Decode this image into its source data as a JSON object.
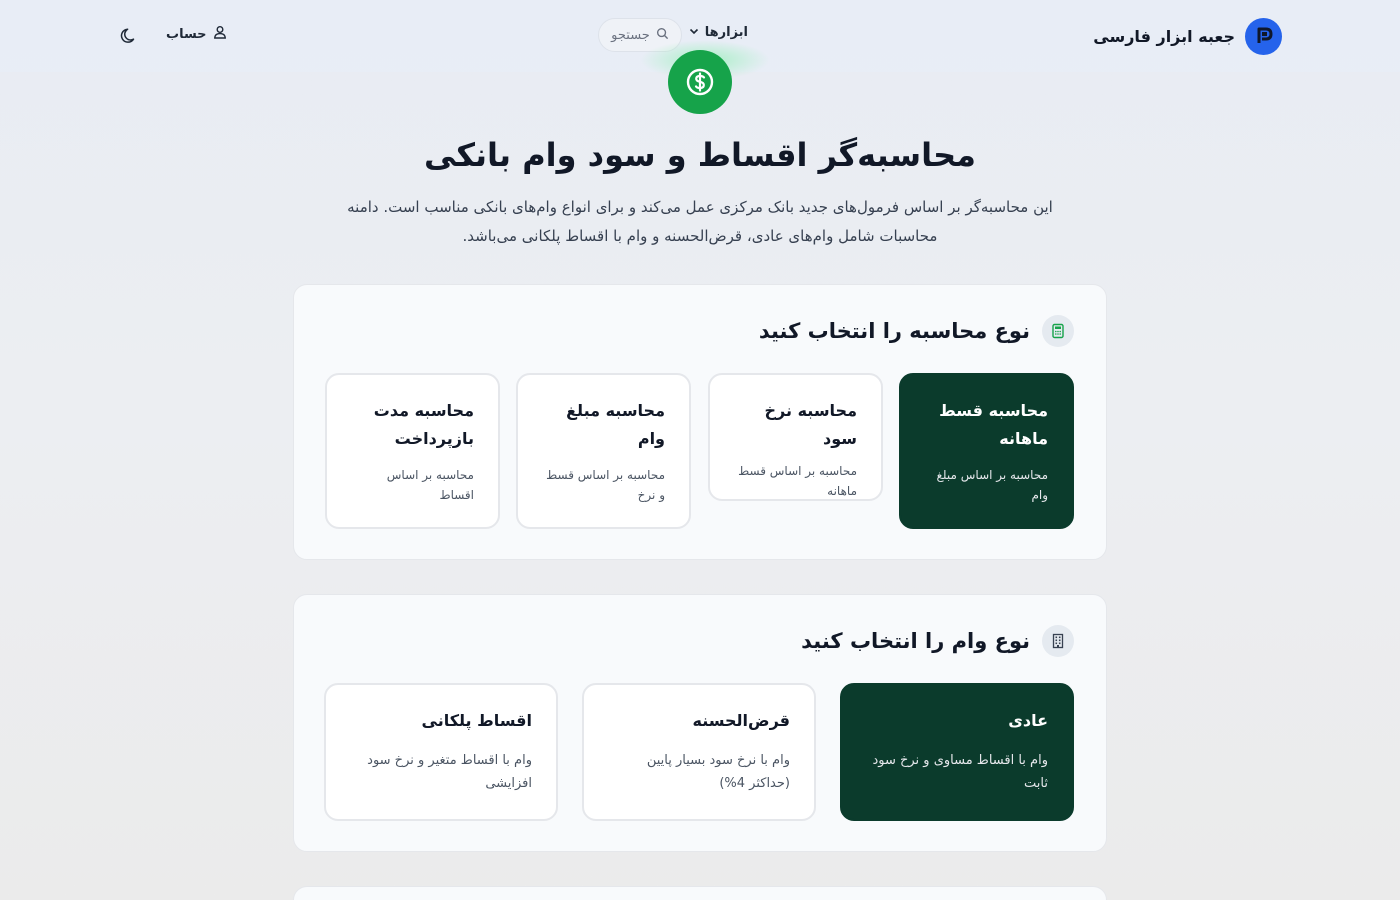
{
  "header": {
    "brand_name": "جعبه ابزار فارسی",
    "brand_icon": "p-logo-icon",
    "tools_label": "ابزارها",
    "search_label": "جستجو",
    "account_label": "حساب",
    "theme_icon": "moon-icon"
  },
  "hero": {
    "icon": "dollar-coin-icon",
    "title": "محاسبه‌گر اقساط و سود وام بانکی",
    "desc_line1": "این محاسبه‌گر بر اساس فرمول‌های جدید بانک مرکزی عمل می‌کند و برای انواع وام‌های بانکی مناسب است. دامنه",
    "desc_line2": "محاسبات شامل وام‌های عادی، قرض‌الحسنه و وام با اقساط پلکانی می‌باشد."
  },
  "calc_section": {
    "title": "نوع محاسبه را انتخاب کنید",
    "icon": "calculator-icon",
    "options": [
      {
        "title": "محاسبه قسط ماهانه",
        "desc": "محاسبه بر اساس مبلغ وام",
        "selected": true
      },
      {
        "title": "محاسبه نرخ سود",
        "desc": "محاسبه بر اساس قسط ماهانه",
        "selected": false
      },
      {
        "title": "محاسبه مبلغ وام",
        "desc": "محاسبه بر اساس قسط و نرخ",
        "selected": false
      },
      {
        "title": "محاسبه مدت بازپرداخت",
        "desc": "محاسبه بر اساس اقساط",
        "selected": false
      }
    ]
  },
  "loan_section": {
    "title": "نوع وام را انتخاب کنید",
    "icon": "building-icon",
    "options": [
      {
        "title": "عادی",
        "desc": "وام با اقساط مساوی و نرخ سود ثابت",
        "selected": true
      },
      {
        "title": "قرض‌الحسنه",
        "desc": "وام با نرخ سود بسیار پایین (حداکثر 4%)",
        "selected": false
      },
      {
        "title": "اقساط پلکانی",
        "desc": "وام با اقساط متغیر و نرخ سود افزایشی",
        "selected": false
      }
    ]
  },
  "colors": {
    "accent_green": "#16a34a",
    "selected_card": "#0b3b2c",
    "brand_blue": "#2563eb"
  }
}
